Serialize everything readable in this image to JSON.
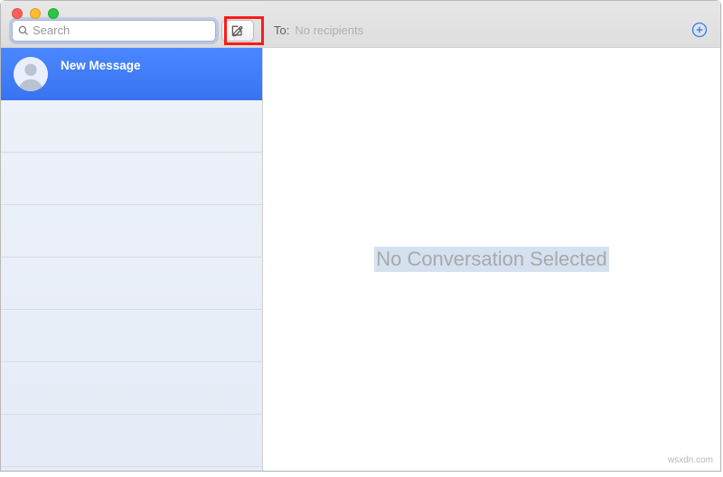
{
  "search": {
    "placeholder": "Search",
    "value": ""
  },
  "conversations": [
    {
      "title": "New Message",
      "selected": true
    }
  ],
  "to_field": {
    "label": "To:",
    "placeholder": "No recipients"
  },
  "main": {
    "empty_text": "No Conversation Selected"
  },
  "watermark": "wsxdn.com",
  "icons": {
    "search": "search-icon",
    "compose": "compose-icon",
    "avatar": "avatar-silhouette",
    "add": "add-recipient-icon"
  },
  "colors": {
    "selection": "#3e7df4",
    "highlight": "#ff1a1a",
    "accent": "#2f7df6"
  }
}
